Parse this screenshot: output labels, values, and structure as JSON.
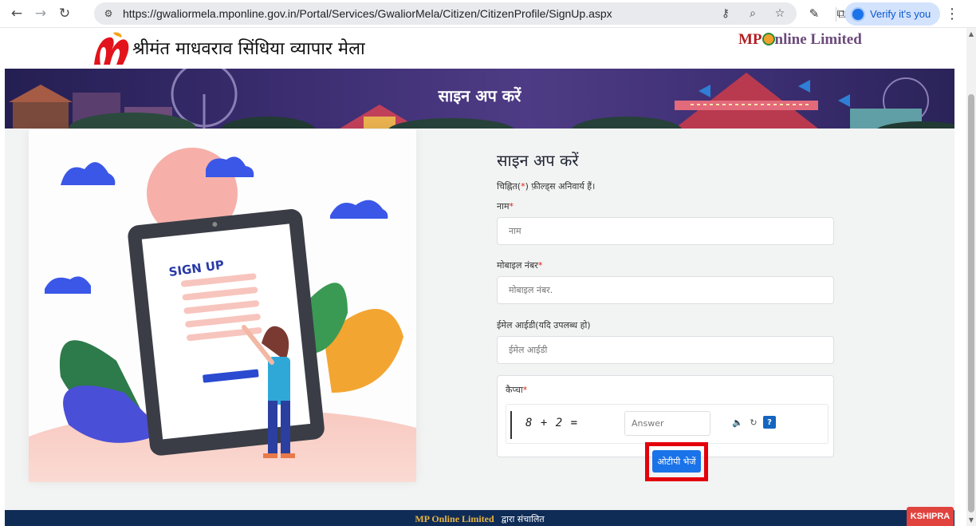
{
  "browser": {
    "url": "https://gwaliormela.mponline.gov.in/Portal/Services/GwaliorMela/Citizen/CitizenProfile/SignUp.aspx",
    "verify_label": "Verify it's you",
    "icons": [
      "back-icon",
      "forward-icon",
      "reload-icon",
      "site-info-icon",
      "password-key-icon",
      "zoom-icon",
      "bookmark-star-icon",
      "pen-icon",
      "extensions-icon",
      "kebab-menu-icon"
    ]
  },
  "header": {
    "site_title": "श्रीमंत माधवराव सिंधिया व्यापार मेला",
    "partner_logo_text": "MP Online Limited"
  },
  "banner": {
    "title": "साइन अप करें"
  },
  "illustration": {
    "tablet_heading": "SIGN UP"
  },
  "form": {
    "title": "साइन अप करें",
    "note_prefix": "चिह्नित(",
    "note_star": "*",
    "note_suffix": ") फ़ील्ड्स अनिवार्य हैं।",
    "name_label": "नाम",
    "name_placeholder": "नाम",
    "mobile_label": "मोबाइल नंबर",
    "mobile_placeholder": "मोबाइल नंबर.",
    "email_label": "ईमेल आईडी(यदि उपलब्ध हो)",
    "email_placeholder": "ईमेल आईडी",
    "captcha_label": "कैप्चा",
    "captcha_question": "8 + 2 =",
    "captcha_answer_placeholder": "Answer",
    "captcha_help": "?",
    "required_mark": "*",
    "submit_label": "ओटीपी भेजें"
  },
  "footer": {
    "brand": "MP Online Limited",
    "text": "द्वारा संचालित"
  },
  "chat_widget": {
    "label": "KSHIPRA"
  },
  "colors": {
    "banner": "#3b2d70",
    "button": "#1a73e8",
    "highlight": "#e3000b",
    "footer": "#0f2c57",
    "required": "#d9201a",
    "chat": "#e0433e"
  }
}
